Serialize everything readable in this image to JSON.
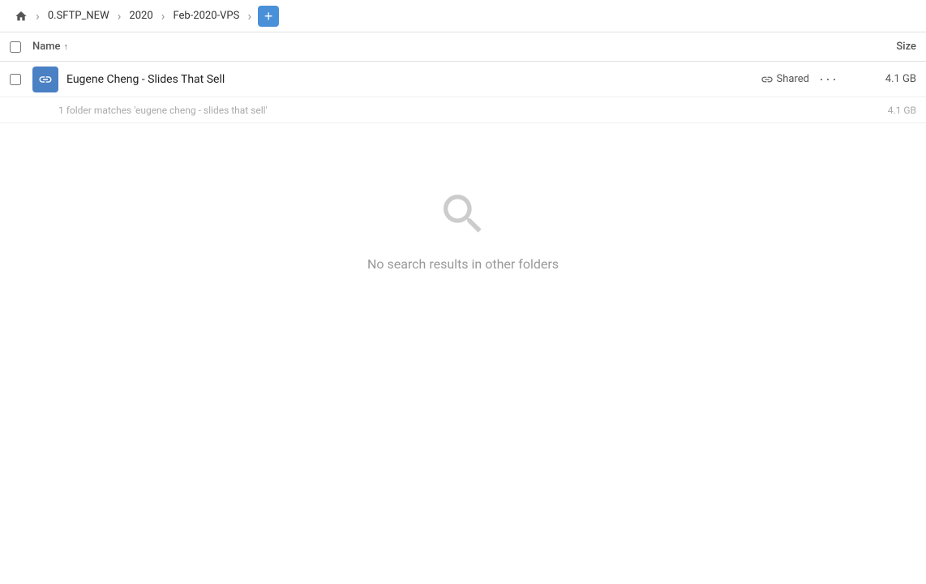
{
  "breadcrumb": {
    "home_icon": "home",
    "items": [
      {
        "label": "0.SFTP_NEW"
      },
      {
        "label": "2020"
      },
      {
        "label": "Feb-2020-VPS"
      }
    ],
    "add_button_label": "+"
  },
  "column_header": {
    "name_label": "Name",
    "sort_arrow": "↑",
    "size_label": "Size"
  },
  "file_row": {
    "name": "Eugene Cheng - Slides That Sell",
    "shared_label": "Shared",
    "size": "4.1 GB",
    "more_label": "···"
  },
  "match_row": {
    "text": "1 folder matches 'eugene cheng - slides that sell'",
    "size": "4.1 GB"
  },
  "empty_state": {
    "icon": "search",
    "text": "No search results in other folders"
  }
}
